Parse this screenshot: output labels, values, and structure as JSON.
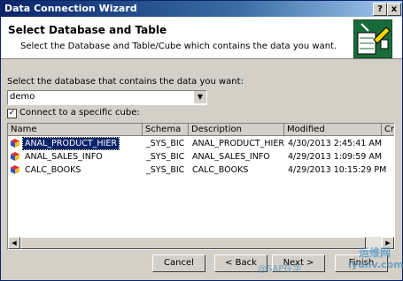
{
  "window": {
    "title": "Data Connection Wizard",
    "help_glyph": "?",
    "close_glyph": "x"
  },
  "header": {
    "title": "Select Database and Table",
    "subtitle": "Select the Database and Table/Cube which contains the data you want."
  },
  "database": {
    "label": "Select the database that contains the data you want:",
    "value": "demo"
  },
  "connect_cube": {
    "label": "Connect to a specific cube:",
    "checked": true,
    "check_glyph": "✓"
  },
  "table": {
    "columns": [
      "Name",
      "Schema",
      "Description",
      "Modified",
      "Cr"
    ],
    "rows": [
      {
        "name": "ANAL_PRODUCT_HIER",
        "schema": "_SYS_BIC",
        "description": "ANAL_PRODUCT_HIER",
        "modified": "4/30/2013 2:45:41 AM",
        "selected": true
      },
      {
        "name": "ANAL_SALES_INFO",
        "schema": "_SYS_BIC",
        "description": "ANAL_SALES_INFO",
        "modified": "4/29/2013 1:09:59 AM",
        "selected": false
      },
      {
        "name": "CALC_BOOKS",
        "schema": "_SYS_BIC",
        "description": "CALC_BOOKS",
        "modified": "4/29/2013 10:15:29 PM",
        "selected": false
      }
    ]
  },
  "buttons": {
    "cancel": "Cancel",
    "back": "< Back",
    "next": "Next >",
    "finish": "Finish"
  },
  "watermark": {
    "cn": "运维网",
    "site": "iyunv.com",
    "blog": "@SAP在华"
  },
  "colors": {
    "title_bar": "#0a246a",
    "selection": "#0a246a",
    "dialog": "#d4d0c8"
  }
}
